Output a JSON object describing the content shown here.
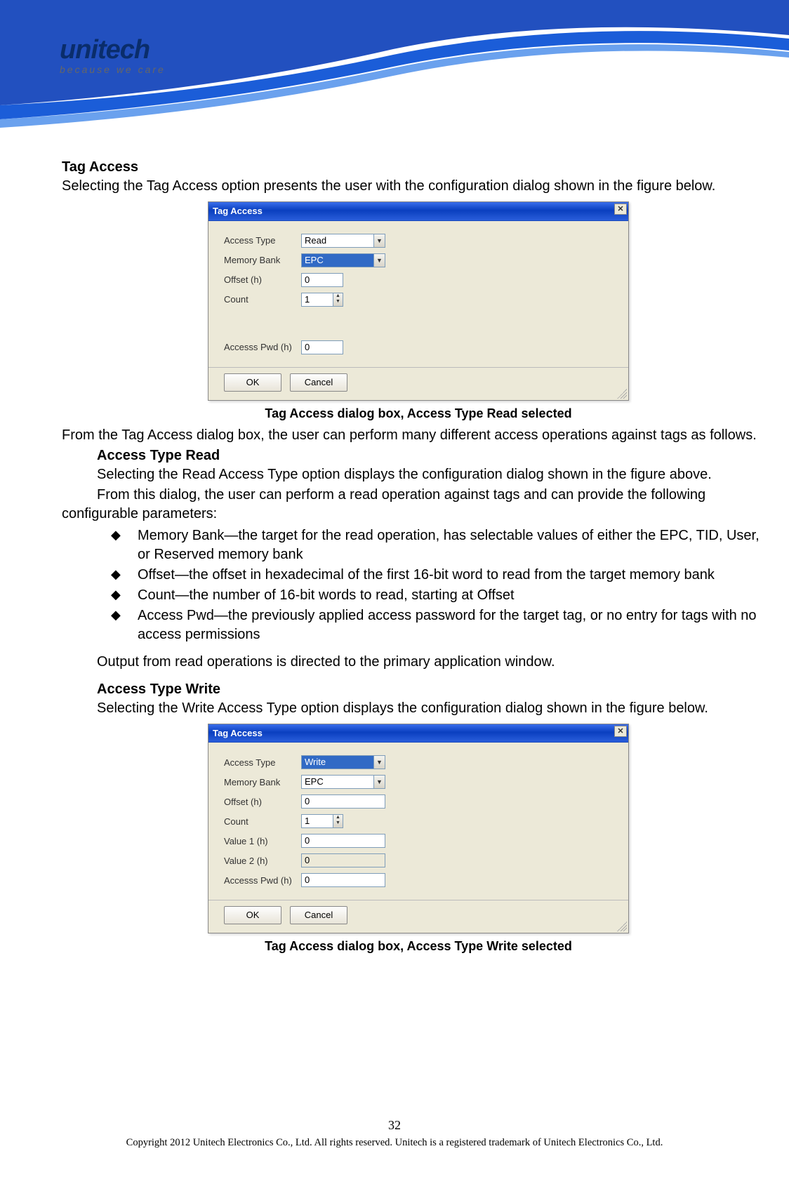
{
  "logo": {
    "name": "unitech",
    "tagline": "because we care"
  },
  "section1": {
    "title": "Tag Access",
    "intro": "Selecting the Tag Access option presents the user with the configuration dialog shown in the figure below."
  },
  "dialog1": {
    "title": "Tag Access",
    "close": "✕",
    "fields": {
      "accessType": {
        "label": "Access Type",
        "value": "Read"
      },
      "memoryBank": {
        "label": "Memory Bank",
        "value": "EPC"
      },
      "offset": {
        "label": "Offset (h)",
        "value": "0"
      },
      "count": {
        "label": "Count",
        "value": "1"
      },
      "accessPwd": {
        "label": "Accesss Pwd (h)",
        "value": "0"
      }
    },
    "ok": "OK",
    "cancel": "Cancel",
    "caption": "Tag Access dialog box, Access Type Read selected"
  },
  "body": {
    "p1": "From the Tag Access dialog box, the user can perform many different access operations against tags as follows.",
    "readTitle": "Access Type Read",
    "p2": "Selecting the Read Access Type option displays the configuration dialog shown in the figure above.",
    "p3": "From this dialog, the user can perform a read operation against tags and can provide the following configurable parameters:",
    "bullets": [
      "Memory Bank—the target for the read operation, has selectable values of either the EPC, TID, User, or Reserved memory bank",
      "Offset—the offset in hexadecimal of the first 16-bit word to read from the target memory bank",
      "Count—the number of 16-bit words to read, starting at Offset",
      "Access Pwd—the previously applied access password for the target tag, or no entry for tags with no access permissions"
    ],
    "p4": "Output from read operations is directed to the primary application window.",
    "writeTitle": "Access Type Write",
    "p5": "Selecting the Write Access Type option displays the configuration dialog shown in the figure below."
  },
  "dialog2": {
    "title": "Tag Access",
    "close": "✕",
    "fields": {
      "accessType": {
        "label": "Access Type",
        "value": "Write"
      },
      "memoryBank": {
        "label": "Memory Bank",
        "value": "EPC"
      },
      "offset": {
        "label": "Offset (h)",
        "value": "0"
      },
      "count": {
        "label": "Count",
        "value": "1"
      },
      "value1": {
        "label": "Value 1 (h)",
        "value": "0"
      },
      "value2": {
        "label": "Value 2 (h)",
        "value": "0"
      },
      "accessPwd": {
        "label": "Accesss Pwd (h)",
        "value": "0"
      }
    },
    "ok": "OK",
    "cancel": "Cancel",
    "caption": "Tag Access dialog box, Access Type Write selected"
  },
  "footer": {
    "page": "32",
    "copyright": "Copyright 2012 Unitech Electronics Co., Ltd. All rights reserved. Unitech is a registered trademark of Unitech Electronics Co., Ltd."
  }
}
